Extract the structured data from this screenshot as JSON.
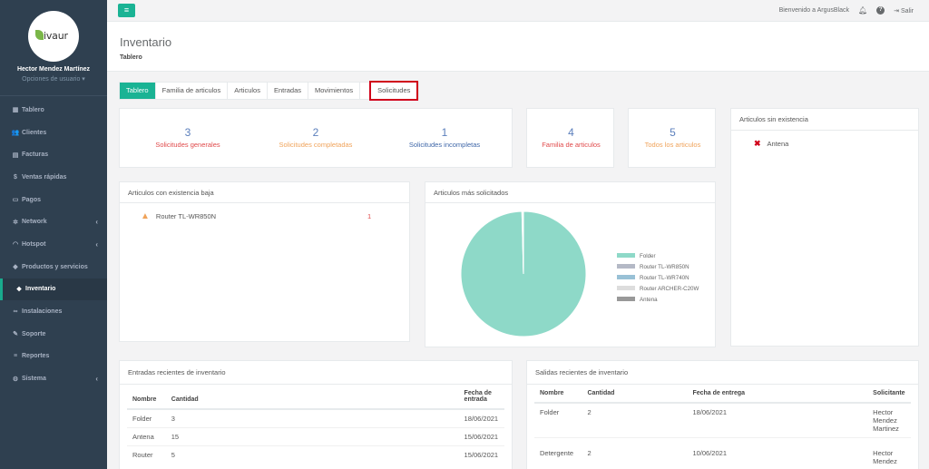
{
  "profile": {
    "logo_text": "ivaur",
    "name": "Hector Mendez Martínez",
    "options": "Opciones de usuario ▾"
  },
  "nav": [
    {
      "label": "Tablero",
      "icon": "dashboard-icon",
      "glyph": "▦"
    },
    {
      "label": "Clientes",
      "icon": "users-icon",
      "glyph": "👥"
    },
    {
      "label": "Facturas",
      "icon": "invoice-icon",
      "glyph": "▤"
    },
    {
      "label": "Ventas rápidas",
      "icon": "dollar-icon",
      "glyph": "$"
    },
    {
      "label": "Pagos",
      "icon": "money-icon",
      "glyph": "▭"
    },
    {
      "label": "Network",
      "icon": "network-icon",
      "glyph": "✲"
    },
    {
      "label": "Hotspot",
      "icon": "wifi-icon",
      "glyph": "◠"
    },
    {
      "label": "Productos y servicios",
      "icon": "tag-icon",
      "glyph": "◆"
    },
    {
      "label": "Inventario",
      "icon": "cubes-icon",
      "glyph": "❖"
    },
    {
      "label": "Instalaciones",
      "icon": "link-icon",
      "glyph": "∞"
    },
    {
      "label": "Soporte",
      "icon": "wrench-icon",
      "glyph": "✎"
    },
    {
      "label": "Reportes",
      "icon": "database-icon",
      "glyph": "≡"
    },
    {
      "label": "Sistema",
      "icon": "cogs-icon",
      "glyph": "⚙"
    }
  ],
  "topbar": {
    "welcome": "Bienvenido a ArgusBlack",
    "logout": "Salir"
  },
  "heading": {
    "title": "Inventario",
    "breadcrumb": "Tablero"
  },
  "tabs": [
    "Tablero",
    "Familia de articulos",
    "Articulos",
    "Entradas",
    "Movimientos",
    "Solicitudes"
  ],
  "stats_solicitudes": [
    {
      "value": "3",
      "label": "Solicitudes generales",
      "color": "#e0494a"
    },
    {
      "value": "2",
      "label": "Solicitudes completadas",
      "color": "#f0a35a"
    },
    {
      "value": "1",
      "label": "Solicitudes incompletas",
      "color": "#3f67a8"
    }
  ],
  "stat_familia": {
    "value": "4",
    "label": "Familia de articulos"
  },
  "stat_todos": {
    "value": "5",
    "label": "Todos los articulos"
  },
  "sin_existencia": {
    "title": "Articulos sin existencia",
    "items": [
      "Antena"
    ]
  },
  "existencia_baja": {
    "title": "Articulos con existencia baja",
    "items": [
      {
        "name": "Router TL-WR850N",
        "qty": "1"
      }
    ]
  },
  "mas_solicitados": {
    "title": "Articulos más solicitados"
  },
  "chart_data": {
    "type": "pie",
    "title": "",
    "categories": [
      "Folder",
      "Router TL-WR850N",
      "Router TL-WR740N",
      "Router ARCHER-C20W",
      "Antena"
    ],
    "values": [
      99.6,
      0.1,
      0.1,
      0.1,
      0.1
    ],
    "colors": [
      "#8ed9c8",
      "#b4b9c6",
      "#99c1d6",
      "#dddddd",
      "#999999"
    ],
    "legend": "right"
  },
  "entradas": {
    "title": "Entradas recientes de inventario",
    "headers": [
      "Nombre",
      "Cantidad",
      "Fecha de entrada"
    ],
    "rows": [
      [
        "Folder",
        "3",
        "18/06/2021"
      ],
      [
        "Antena",
        "15",
        "15/06/2021"
      ],
      [
        "Router",
        "5",
        "15/06/2021"
      ]
    ]
  },
  "salidas": {
    "title": "Salidas recientes de inventario",
    "headers": [
      "Nombre",
      "Cantidad",
      "Fecha de entrega",
      "Solicitante"
    ],
    "rows": [
      [
        "Folder",
        "2",
        "18/06/2021",
        "Hector Mendez Martinez"
      ],
      [
        "Detergente",
        "2",
        "10/06/2021",
        "Hector Mendez"
      ]
    ]
  }
}
